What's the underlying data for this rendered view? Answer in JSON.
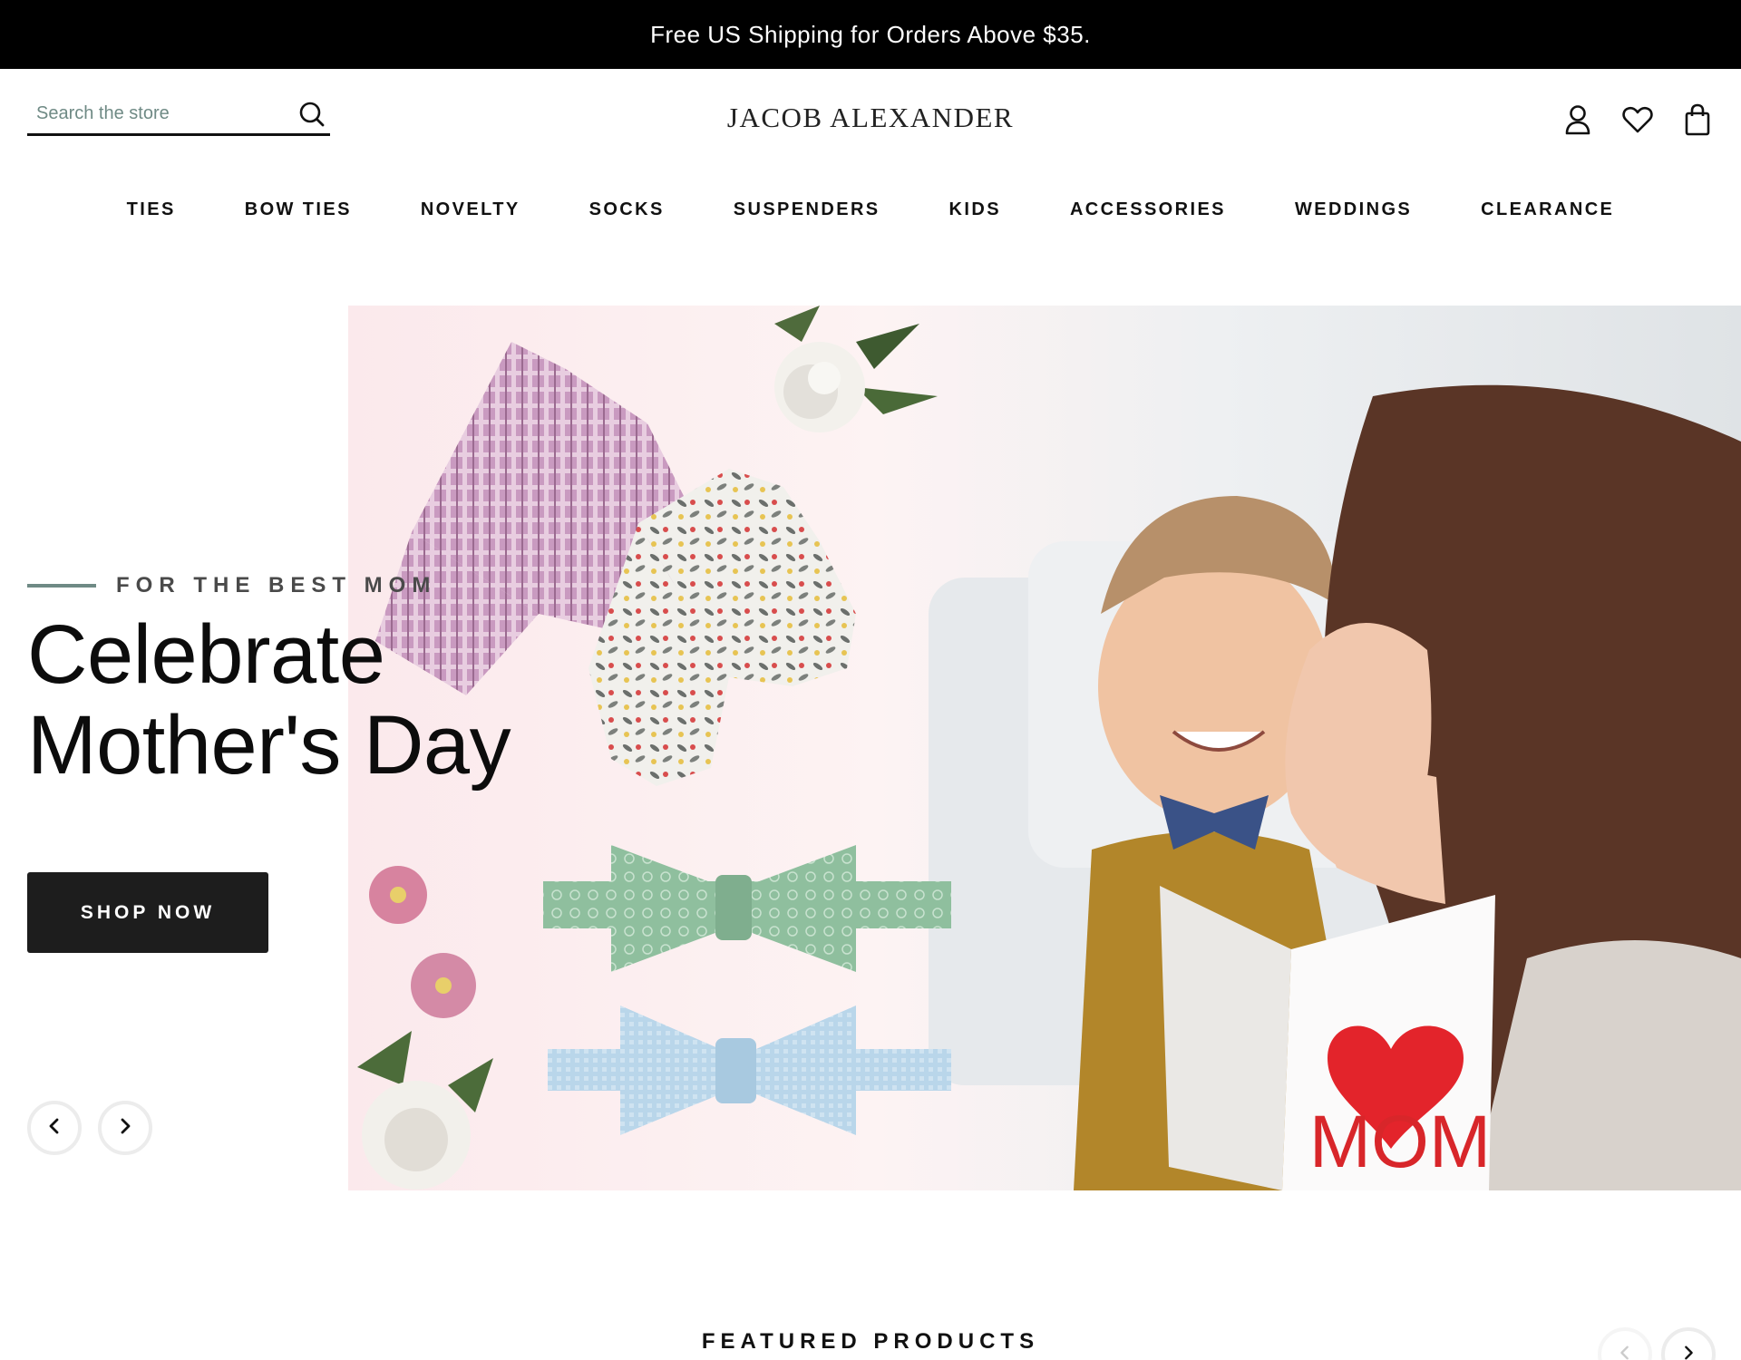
{
  "announcement": {
    "text": "Free US Shipping for Orders Above $35."
  },
  "header": {
    "search": {
      "placeholder": "Search the store"
    },
    "logo": "JACOB ALEXANDER",
    "icons": [
      "account-icon",
      "wishlist-heart-icon",
      "cart-bag-icon"
    ]
  },
  "nav": {
    "items": [
      {
        "label": "TIES"
      },
      {
        "label": "BOW TIES"
      },
      {
        "label": "NOVELTY"
      },
      {
        "label": "SOCKS"
      },
      {
        "label": "SUSPENDERS"
      },
      {
        "label": "KIDS"
      },
      {
        "label": "ACCESSORIES"
      },
      {
        "label": "WEDDINGS"
      },
      {
        "label": "CLEARANCE"
      }
    ]
  },
  "hero": {
    "kicker": "FOR THE BEST MOM",
    "headline_line1": "Celebrate",
    "headline_line2": "Mother's Day",
    "cta": "SHOP NOW",
    "card_text": "MOM"
  },
  "featured": {
    "title": "FEATURED PRODUCTS"
  },
  "colors": {
    "accent": "#6f8a85",
    "button": "#1d1d1d",
    "announcement_bg": "#000000"
  }
}
